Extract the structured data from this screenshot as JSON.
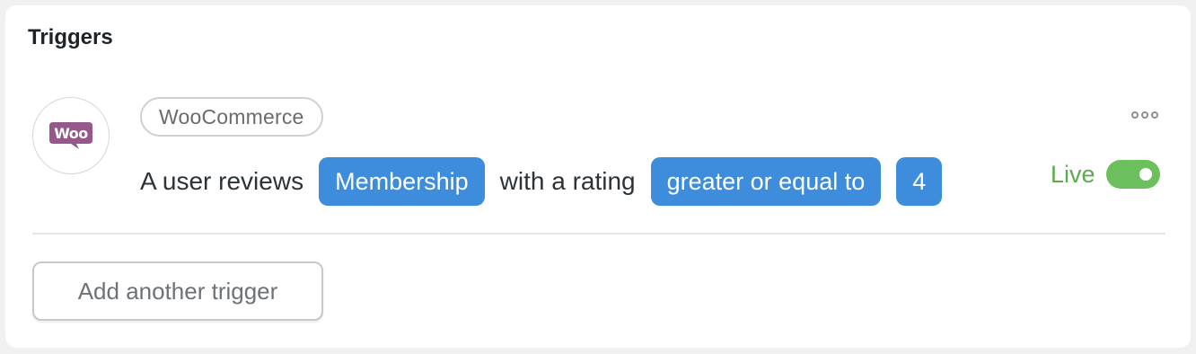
{
  "card": {
    "title": "Triggers"
  },
  "trigger": {
    "integration_icon": "woocommerce-logo",
    "integration_logo_text": "Woo",
    "integration_label": "WooCommerce",
    "sentence": {
      "part1": "A user reviews",
      "token1": "Membership",
      "part2": "with a rating",
      "token2": "greater or equal to",
      "token3": "4"
    },
    "status_label": "Live",
    "live_enabled": true,
    "more_icon": "ellipsis-icon"
  },
  "actions": {
    "add_trigger_label": "Add another trigger"
  },
  "colors": {
    "token_blue": "#3e8ddd",
    "live_green": "#5daa4f",
    "woo_purple": "#96588a"
  }
}
